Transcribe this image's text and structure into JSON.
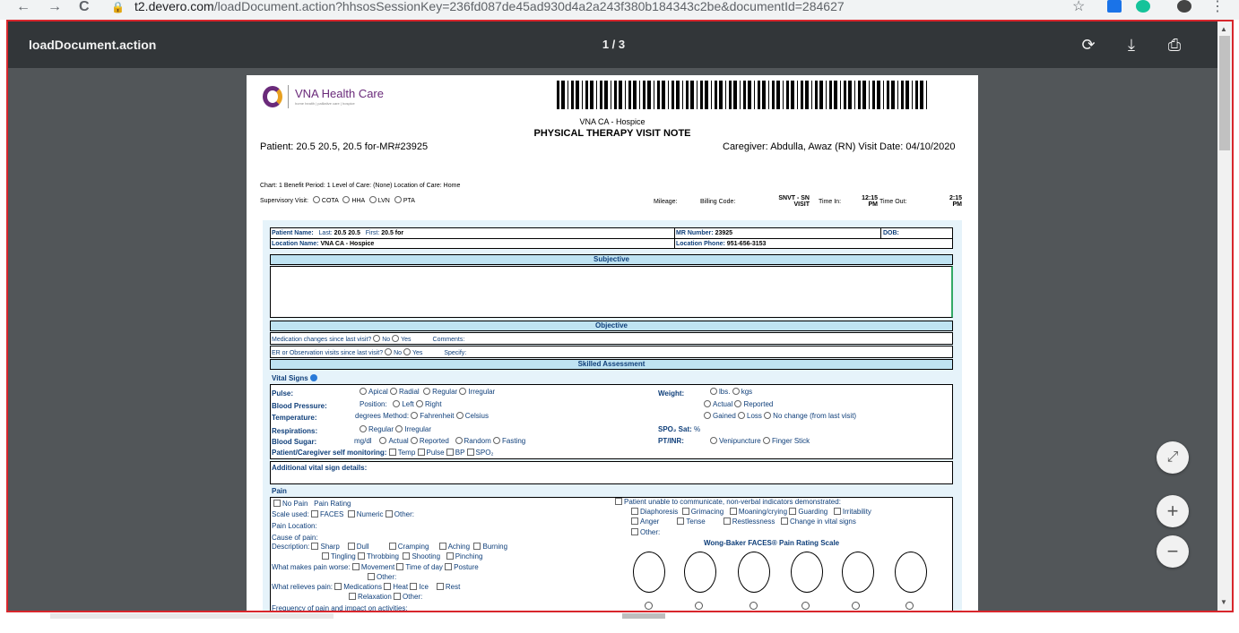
{
  "browser": {
    "url_host": "t2.devero.com",
    "url_path": "/loadDocument.action?hhsosSessionKey=236fd087de45ad930d4a2a243f380b184343c2be&documentId=284627",
    "back": "←",
    "forward": "→",
    "reload": "C",
    "star": "☆",
    "menu": "⋮"
  },
  "viewer": {
    "doc_name": "loadDocument.action",
    "page_count": "1 / 3",
    "rotate_icon": "⟳",
    "download_icon": "⤓",
    "print_icon": "⎙",
    "fit_icon": "⤢",
    "zoom_in_icon": "+",
    "zoom_out_icon": "−"
  },
  "document": {
    "logo_name": "VNA Health Care",
    "logo_tagline": "home health | palliative care | hospice",
    "agency": "VNA CA - Hospice",
    "form_title": "PHYSICAL THERAPY VISIT NOTE",
    "patient_line": "Patient: 20.5 20.5, 20.5 for-MR#23925",
    "caregiver_line": "Caregiver: Abdulla, Awaz (RN) Visit Date: 04/10/2020",
    "chart_line": "Chart: 1 Benefit Period: 1 Level of Care: (None) Location of Care: Home",
    "supervisory_label": "Supervisory Visit:",
    "supervisory_options": [
      "COTA",
      "HHA",
      "LVN",
      "PTA"
    ],
    "mileage_label": "Mileage:",
    "billing_label": "Billing Code:",
    "billing_value_1": "SNVT - SN",
    "billing_value_2": "VISIT",
    "time_in_label": "Time In:",
    "time_in_1": "12:15",
    "time_in_2": "PM",
    "time_out_label": "Time Out:",
    "time_out_1": "2:15",
    "time_out_2": "PM",
    "patient_name_label": "Patient Name:",
    "last_label": "Last:",
    "last_value": "20.5 20.5",
    "first_label": "First:",
    "first_value": "20.5 for",
    "mr_label": "MR Number:",
    "mr_value": "23925",
    "dob_label": "DOB:",
    "location_name_label": "Location Name:",
    "location_name_value": "VNA CA - Hospice",
    "location_phone_label": "Location Phone:",
    "location_phone_value": "951-656-3153",
    "subjective": "Subjective",
    "objective": "Objective",
    "med_changes": "Medication changes since last visit?",
    "no": "No",
    "yes": "Yes",
    "comments": "Comments:",
    "er_visits": "ER or Observation visits since last visit?",
    "specify": "Specify:",
    "skilled_assessment": "Skilled Assessment",
    "vital_signs": "Vital Signs",
    "pulse": "Pulse:",
    "pulse_opts": [
      "Apical",
      "Radial",
      "Regular",
      "Irregular"
    ],
    "weight": "Weight:",
    "weight_opts": [
      "lbs.",
      "kgs"
    ],
    "bp": "Blood Pressure:",
    "position": "Position:",
    "left": "Left",
    "right": "Right",
    "actual": "Actual",
    "reported": "Reported",
    "temperature": "Temperature:",
    "temp_detail": "degrees  Method:",
    "fahrenheit": "Fahrenheit",
    "celsius": "Celsius",
    "gained": "Gained",
    "loss": "Loss",
    "no_change": "No change (from last visit)",
    "respirations": "Respirations:",
    "regular": "Regular",
    "irregular": "Irregular",
    "spo2_sat": "SPO₂ Sat:",
    "percent": "%",
    "blood_sugar": "Blood Sugar:",
    "mgdl": "mg/dl",
    "random": "Random",
    "fasting": "Fasting",
    "ptinr": "PT/INR:",
    "venipuncture": "Venipuncture",
    "finger_stick": "Finger Stick",
    "self_monitoring": "Patient/Caregiver self monitoring:",
    "self_opts": [
      "Temp",
      "Pulse",
      "BP",
      "SPO₂"
    ],
    "additional_vitals": "Additional vital sign details:",
    "pain": "Pain",
    "no_pain": "No Pain",
    "pain_rating": "Pain Rating",
    "scale_used": "Scale used:",
    "faces": "FACES",
    "numeric": "Numeric",
    "other": "Other:",
    "pain_location": "Pain Location:",
    "cause_of_pain": "Cause of pain:",
    "description": "Description:",
    "desc_row1": [
      "Sharp",
      "Dull",
      "Cramping",
      "Aching",
      "Burning"
    ],
    "desc_row2": [
      "Tingling",
      "Throbbing",
      "Shooting",
      "Pinching"
    ],
    "makes_worse": "What makes pain worse:",
    "worse_opts": [
      "Movement",
      "Time of day",
      "Posture"
    ],
    "relieves": "What relieves pain:",
    "relieve_opts": [
      "Medications",
      "Heat",
      "Ice",
      "Rest"
    ],
    "relaxation": "Relaxation",
    "frequency": "Frequency of pain and impact on activities:",
    "unable": "Patient unable to communicate, non-verbal indicators demonstrated:",
    "indicators_row1": [
      "Diaphoresis",
      "Grimacing",
      "Moaning/crying",
      "Guarding",
      "Irritability"
    ],
    "indicators_row2": [
      "Anger",
      "Tense",
      "Restlessness",
      "Change in vital signs"
    ],
    "wong_baker": "Wong-Baker FACES® Pain Rating Scale"
  }
}
